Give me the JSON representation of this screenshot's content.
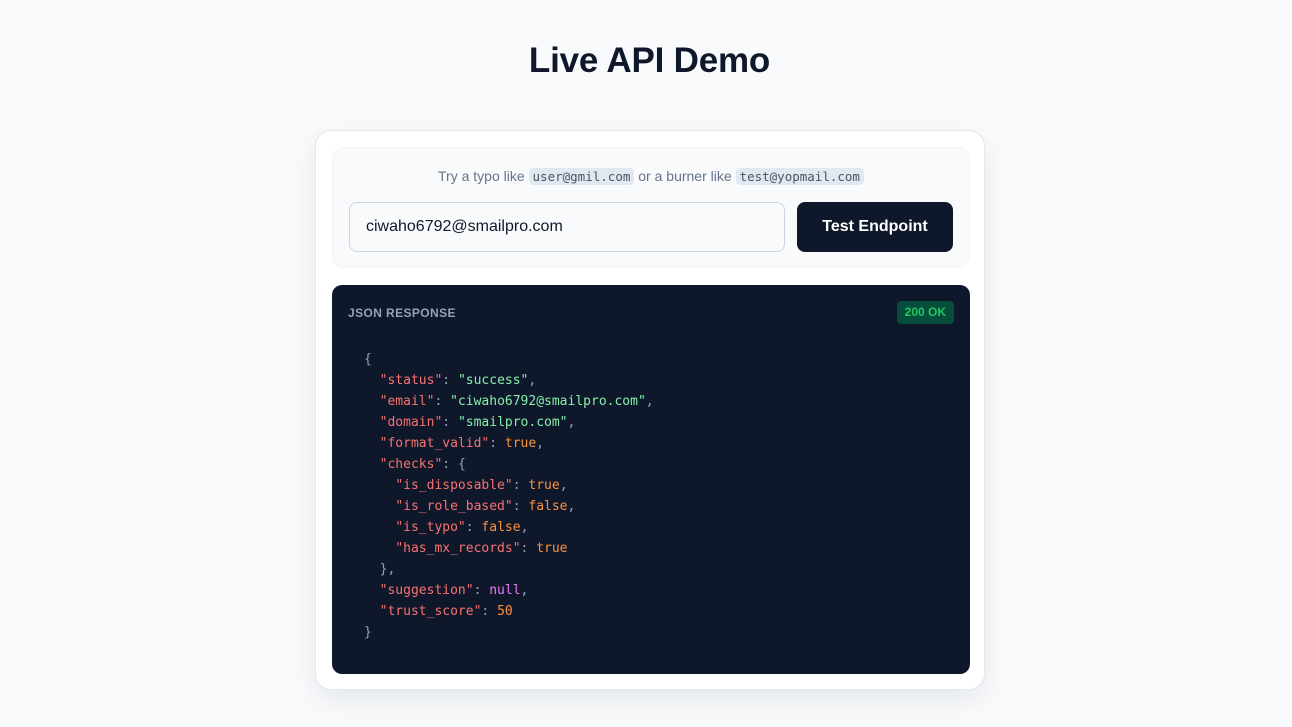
{
  "page": {
    "title": "Live API Demo"
  },
  "demo": {
    "hint_before": "Try a typo like ",
    "hint_example_typo": "user@gmil.com",
    "hint_middle": " or a burner like ",
    "hint_example_burner": "test@yopmail.com",
    "email_value": "ciwaho6792@smailpro.com",
    "button_label": "Test Endpoint"
  },
  "response": {
    "label": "JSON RESPONSE",
    "status_badge": "200 OK",
    "lines": [
      {
        "indent": "",
        "key": "",
        "value": "{",
        "value_type": "punct",
        "comma": ""
      },
      {
        "indent": "  ",
        "key": "\"status\"",
        "value": "\"success\"",
        "value_type": "string",
        "comma": ","
      },
      {
        "indent": "  ",
        "key": "\"email\"",
        "value": "\"ciwaho6792@smailpro.com\"",
        "value_type": "string",
        "comma": ","
      },
      {
        "indent": "  ",
        "key": "\"domain\"",
        "value": "\"smailpro.com\"",
        "value_type": "string",
        "comma": ","
      },
      {
        "indent": "  ",
        "key": "\"format_valid\"",
        "value": "true",
        "value_type": "bool",
        "comma": ","
      },
      {
        "indent": "  ",
        "key": "\"checks\"",
        "value": "{",
        "value_type": "punct",
        "comma": ""
      },
      {
        "indent": "    ",
        "key": "\"is_disposable\"",
        "value": "true",
        "value_type": "bool",
        "comma": ","
      },
      {
        "indent": "    ",
        "key": "\"is_role_based\"",
        "value": "false",
        "value_type": "bool",
        "comma": ","
      },
      {
        "indent": "    ",
        "key": "\"is_typo\"",
        "value": "false",
        "value_type": "bool",
        "comma": ","
      },
      {
        "indent": "    ",
        "key": "\"has_mx_records\"",
        "value": "true",
        "value_type": "bool",
        "comma": ""
      },
      {
        "indent": "  ",
        "key": "",
        "value": "}",
        "value_type": "punct",
        "comma": ","
      },
      {
        "indent": "  ",
        "key": "\"suggestion\"",
        "value": "null",
        "value_type": "null",
        "comma": ","
      },
      {
        "indent": "  ",
        "key": "\"trust_score\"",
        "value": "50",
        "value_type": "number",
        "comma": ""
      },
      {
        "indent": "",
        "key": "",
        "value": "}",
        "value_type": "punct",
        "comma": ""
      }
    ]
  },
  "colors": {
    "page_bg": "#f8fafc",
    "title": "#0f172a",
    "button_bg": "#0f172a",
    "response_bg": "#0f172a",
    "json_key": "#f87171",
    "json_string": "#86efac",
    "json_bool": "#fb923c",
    "json_null": "#e879f9",
    "badge_bg": "#064e3b",
    "badge_text": "#22c55e"
  }
}
